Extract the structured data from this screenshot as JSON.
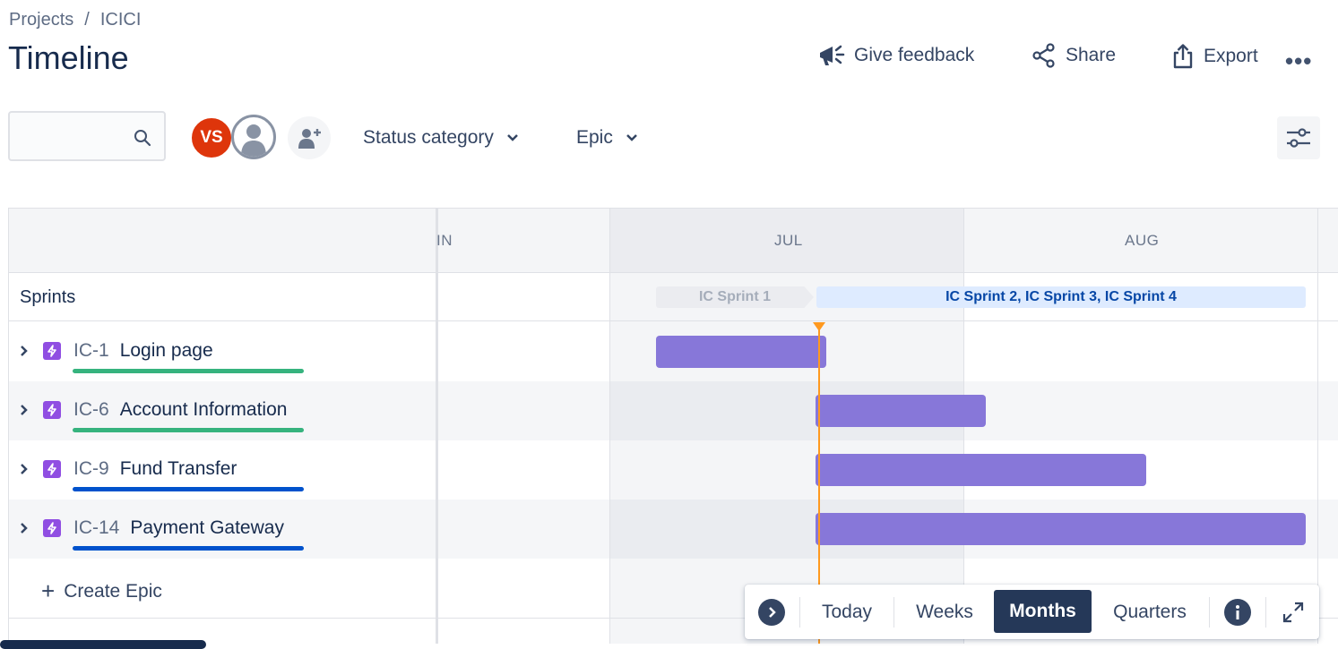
{
  "breadcrumb": {
    "project_link": "Projects",
    "separator": "/",
    "current": "ICICI"
  },
  "page": {
    "title": "Timeline"
  },
  "actions": {
    "feedback": {
      "label": "Give feedback",
      "icon": "megaphone-icon"
    },
    "share": {
      "label": "Share",
      "icon": "share-icon"
    },
    "export": {
      "label": "Export",
      "icon": "export-icon"
    },
    "more": {
      "label": "•••",
      "icon": "more-icon"
    }
  },
  "toolbar": {
    "search": {
      "value": "",
      "placeholder": "",
      "icon": "search-icon"
    },
    "avatars": [
      {
        "initials": "VS",
        "color": "#de350b"
      },
      {
        "initials": "",
        "icon": "default-avatar-icon"
      }
    ],
    "add_people_icon": "add-person-icon",
    "filters": [
      {
        "label": "Status category"
      },
      {
        "label": "Epic"
      }
    ],
    "view_settings_icon": "sliders-icon"
  },
  "timeline": {
    "months": [
      "IN",
      "JUL",
      "AUG"
    ],
    "sprints_label": "Sprints",
    "sprints": [
      {
        "label": "IC Sprint 1",
        "state": "closed"
      },
      {
        "label": "IC Sprint 2, IC Sprint 3, IC Sprint 4",
        "state": "active"
      }
    ],
    "epics": [
      {
        "key": "IC-1",
        "name": "Login page",
        "progress_color": "#36b37e"
      },
      {
        "key": "IC-6",
        "name": "Account Information",
        "progress_color": "#36b37e"
      },
      {
        "key": "IC-9",
        "name": "Fund Transfer",
        "progress_color": "#0052cc"
      },
      {
        "key": "IC-14",
        "name": "Payment Gateway",
        "progress_color": "#0052cc"
      }
    ],
    "create_epic": {
      "plus": "+",
      "label": "Create Epic"
    },
    "bar_color": "#8777d9",
    "today_color": "#ff991f"
  },
  "controls": {
    "today": "Today",
    "weeks": "Weeks",
    "months": "Months",
    "quarters": "Quarters",
    "selected": "Months"
  },
  "colors": {
    "accent": "#0052cc",
    "text": "#172b4d",
    "epic_icon": "#904ee2"
  }
}
